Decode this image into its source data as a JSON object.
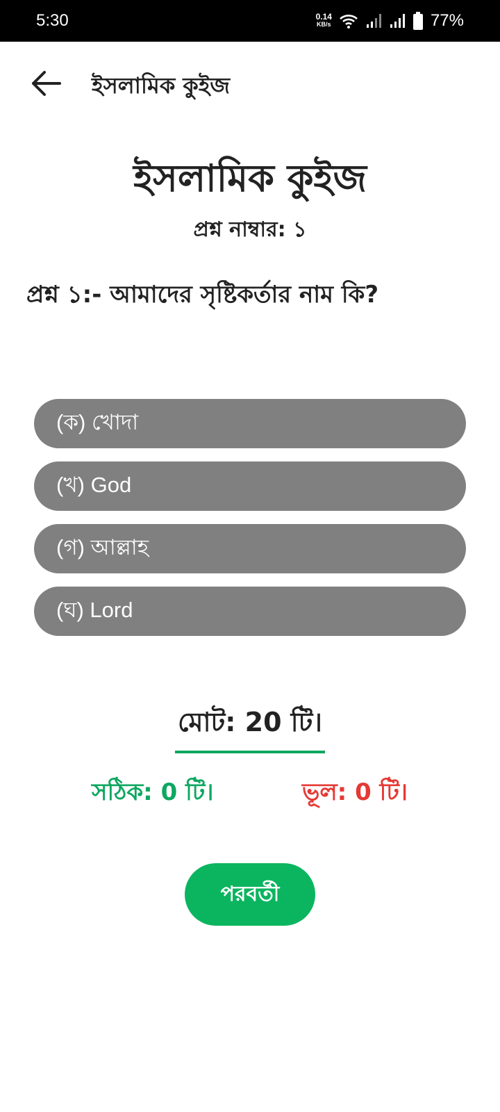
{
  "status_bar": {
    "time": "5:30",
    "net_speed_value": "0.14",
    "net_speed_unit": "KB/s",
    "battery_percent": "77%",
    "icons": [
      "wifi-icon",
      "signal-icon",
      "signal-icon",
      "battery-icon"
    ]
  },
  "app_bar": {
    "title": "ইসলামিক কুইজ",
    "back_icon": "arrow-left-icon"
  },
  "quiz": {
    "heading": "ইসলামিক কুইজ",
    "question_number": "প্রশ্ন নাম্বার: ১",
    "question": "প্রশ্ন ১:- আমাদের সৃষ্টিকর্তার নাম কি?",
    "options": [
      {
        "label": "(ক) খোদা"
      },
      {
        "label": "(খ) God"
      },
      {
        "label": "(গ) আল্লাহ"
      },
      {
        "label": "(ঘ) Lord"
      }
    ]
  },
  "score": {
    "total": "মোট: 20 টি।",
    "correct": "সঠিক: 0 টি।",
    "wrong": "ভূল: 0 টি।"
  },
  "next_button": "পরবর্তী",
  "colors": {
    "option_bg": "#808080",
    "accent_green": "#0bb55f",
    "correct_green": "#0ea760",
    "wrong_red": "#e53935"
  }
}
